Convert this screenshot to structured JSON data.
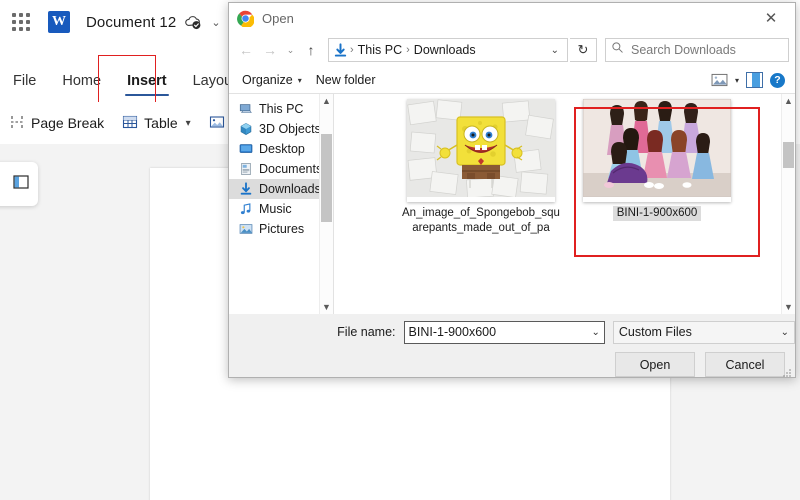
{
  "word": {
    "app_launcher": "app-launcher-icon",
    "logo_letter": "W",
    "document_title": "Document 12",
    "saved_icon": "cloud-saved-icon",
    "title_chevron": "⌄",
    "tabs": [
      {
        "label": "File",
        "active": false
      },
      {
        "label": "Home",
        "active": false
      },
      {
        "label": "Insert",
        "active": true
      },
      {
        "label": "Layout",
        "active": false
      }
    ],
    "toolbar": [
      {
        "label": "Page Break",
        "icon": "page-break-icon",
        "caret": false
      },
      {
        "label": "Table",
        "icon": "table-icon",
        "caret": true
      },
      {
        "label": "Pi",
        "icon": "picture-icon",
        "caret": false
      }
    ],
    "nav_pane_icon": "navigation-pane-icon"
  },
  "dialog": {
    "title": "Open",
    "browser_icon": "chrome-icon",
    "close": "✕",
    "nav": {
      "back": "←",
      "forward": "→",
      "history": "⌄",
      "up": "↑",
      "path_icon": "downloads-arrow-icon",
      "crumbs": [
        "This PC",
        "Downloads"
      ],
      "separator": "›",
      "dropdown": "⌄",
      "refresh": "↻"
    },
    "search": {
      "icon": "search-icon",
      "placeholder": "Search Downloads"
    },
    "toolbar": {
      "organize": "Organize",
      "organize_caret": "▾",
      "new_folder": "New folder",
      "view_icon": "view-mode-icon",
      "view_caret": "▾",
      "pane_icon": "preview-pane-icon",
      "help_icon": "help-icon",
      "help_glyph": "?"
    },
    "sidebar": [
      {
        "label": "This PC",
        "icon": "this-pc-icon",
        "selected": false
      },
      {
        "label": "3D Objects",
        "icon": "3d-objects-icon",
        "selected": false
      },
      {
        "label": "Desktop",
        "icon": "desktop-icon",
        "selected": false
      },
      {
        "label": "Documents",
        "icon": "documents-icon",
        "selected": false
      },
      {
        "label": "Downloads",
        "icon": "downloads-icon",
        "selected": true
      },
      {
        "label": "Music",
        "icon": "music-icon",
        "selected": false
      },
      {
        "label": "Pictures",
        "icon": "pictures-icon",
        "selected": false
      }
    ],
    "files": [
      {
        "name": "An_image_of_Spongebob_squarepants_made_out_of_pa",
        "thumb": "spongebob-thumbnail",
        "selected": false
      },
      {
        "name": "BINI-1-900x600",
        "thumb": "bini-group-thumbnail",
        "selected": true
      }
    ],
    "footer": {
      "file_name_label": "File name:",
      "file_name_value": "BINI-1-900x600",
      "filter_value": "Custom Files",
      "chevron": "⌄",
      "open_button": "Open",
      "cancel_button": "Cancel"
    }
  },
  "annotations": {
    "color": "#e02020",
    "insert_tab_highlight": "insert-tab",
    "selected_file_highlight": "bini-file"
  }
}
